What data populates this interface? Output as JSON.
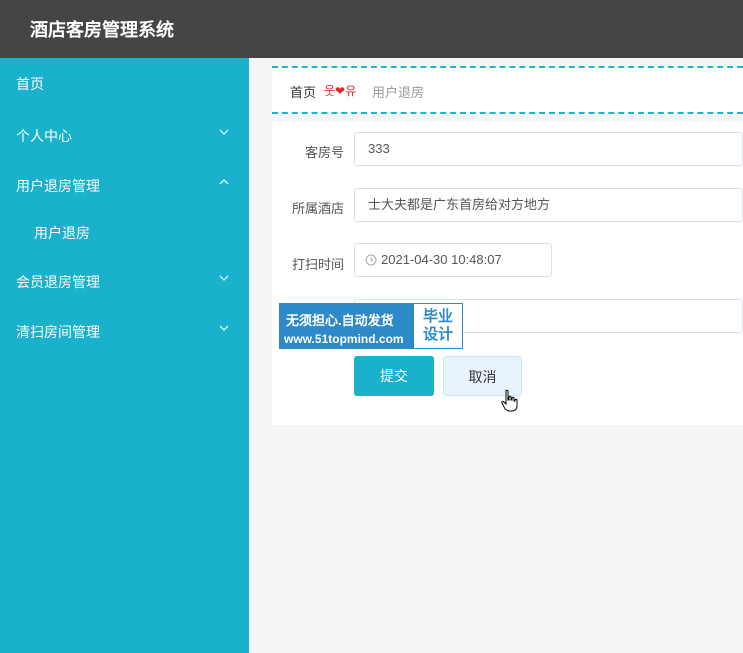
{
  "app": {
    "title": "酒店客房管理系统"
  },
  "sidebar": {
    "items": [
      {
        "label": "首页"
      },
      {
        "label": "个人中心",
        "chevron": "chevron-down-icon"
      },
      {
        "label": "用户退房管理",
        "chevron": "chevron-up-icon"
      },
      {
        "label": "用户退房"
      },
      {
        "label": "会员退房管理",
        "chevron": "chevron-down-icon"
      },
      {
        "label": "清扫房间管理",
        "chevron": "chevron-down-icon"
      }
    ]
  },
  "breadcrumb": {
    "home": "首页",
    "separator": "웃❤유",
    "current": "用户退房"
  },
  "form": {
    "room_no": {
      "label": "客房号",
      "value": "333"
    },
    "hotel": {
      "label": "所属酒店",
      "value": "士大夫都是广东首房给对方地方"
    },
    "clean_time": {
      "label": "打扫时间",
      "value": "2021-04-30 10:48:07"
    },
    "submit_label": "提交",
    "cancel_label": "取消"
  },
  "watermark": {
    "slogan": "无须担心.自动发货",
    "url": "www.51topmind.com",
    "badge_line1": "毕业",
    "badge_line2": "设计"
  },
  "colors": {
    "sidebar": "#19b1cc",
    "topbar": "#454545",
    "accent": "#19b1cc"
  }
}
